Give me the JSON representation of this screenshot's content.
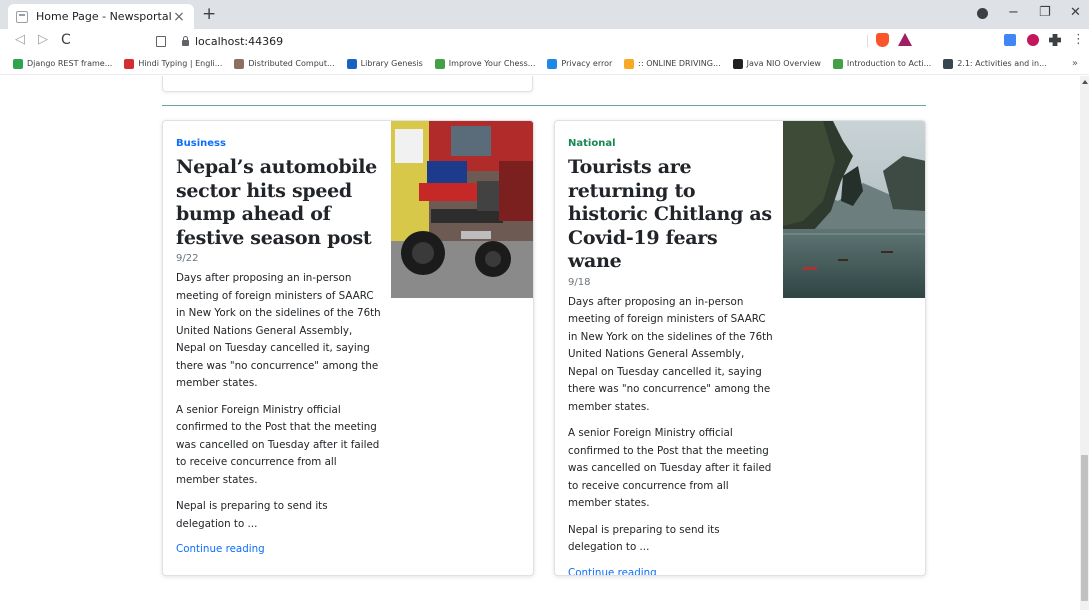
{
  "browser": {
    "tab_title": "Home Page - Newsportal",
    "tab_close": "×",
    "new_tab": "+",
    "url": "localhost:44369",
    "window_controls": {
      "minimize": "−",
      "maximize": "❐",
      "close": "✕"
    },
    "nav": {
      "back": "◁",
      "forward": "▷",
      "reload": "C"
    },
    "menu": "⋮",
    "bookmarks": [
      {
        "label": "Django REST frame...",
        "color": "#2ea44f"
      },
      {
        "label": "Hindi Typing | Engli...",
        "color": "#d32f2f"
      },
      {
        "label": "Distributed Comput...",
        "color": "#8d6e63"
      },
      {
        "label": "Library Genesis",
        "color": "#1565c0"
      },
      {
        "label": "Improve Your Chess...",
        "color": "#43a047"
      },
      {
        "label": "Privacy error",
        "color": "#1e88e5"
      },
      {
        "label": ":: ONLINE DRIVING...",
        "color": "#f9a825"
      },
      {
        "label": "Java NIO Overview",
        "color": "#212121"
      },
      {
        "label": "Introduction to Acti...",
        "color": "#43a047"
      },
      {
        "label": "2.1: Activities and in...",
        "color": "#37474f"
      }
    ],
    "bookmarks_more": "»"
  },
  "articles": [
    {
      "category": "Business",
      "category_color": "#0d6efd",
      "headline": "Nepal’s automobile sector hits speed bump ahead of festive season post",
      "date": "9/22",
      "paragraphs": [
        "Days after proposing an in-person meeting of foreign ministers of SAARC in New York on the sidelines of the 76th United Nations General Assembly, Nepal on Tuesday cancelled it, saying there was \"no concurrence\" among the member states.",
        "A senior Foreign Ministry official confirmed to the Post that the meeting was cancelled on Tuesday after it failed to receive concurrence from all member states.",
        "Nepal is preparing to send its delegation to ..."
      ],
      "link": "Continue reading",
      "image_icon": "motorcycle-showroom-image"
    },
    {
      "category": "National",
      "category_color": "#198754",
      "headline": "Tourists are returning to historic Chitlang as Covid-19 fears wane",
      "date": "9/18",
      "paragraphs": [
        "Days after proposing an in-person meeting of foreign ministers of SAARC in New York on the sidelines of the 76th United Nations General Assembly, Nepal on Tuesday cancelled it, saying there was \"no concurrence\" among the member states.",
        "A senior Foreign Ministry official confirmed to the Post that the meeting was cancelled on Tuesday after it failed to receive concurrence from all member states.",
        "Nepal is preparing to send its delegation to ..."
      ],
      "link": "Continue reading",
      "image_icon": "lake-landscape-image"
    }
  ]
}
